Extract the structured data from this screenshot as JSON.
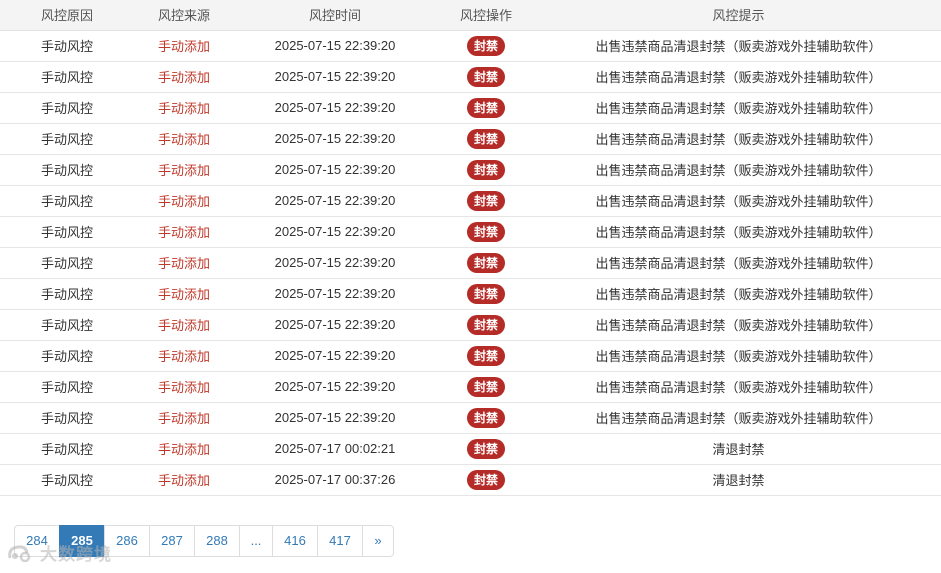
{
  "table": {
    "headers": [
      "风控原因",
      "风控来源",
      "风控时间",
      "风控操作",
      "风控提示"
    ],
    "rows": [
      {
        "reason": "手动风控",
        "source": "手动添加",
        "time": "2025-07-15 22:39:20",
        "action": "封禁",
        "tip": "出售违禁商品清退封禁（贩卖游戏外挂辅助软件）"
      },
      {
        "reason": "手动风控",
        "source": "手动添加",
        "time": "2025-07-15 22:39:20",
        "action": "封禁",
        "tip": "出售违禁商品清退封禁（贩卖游戏外挂辅助软件）"
      },
      {
        "reason": "手动风控",
        "source": "手动添加",
        "time": "2025-07-15 22:39:20",
        "action": "封禁",
        "tip": "出售违禁商品清退封禁（贩卖游戏外挂辅助软件）"
      },
      {
        "reason": "手动风控",
        "source": "手动添加",
        "time": "2025-07-15 22:39:20",
        "action": "封禁",
        "tip": "出售违禁商品清退封禁（贩卖游戏外挂辅助软件）"
      },
      {
        "reason": "手动风控",
        "source": "手动添加",
        "time": "2025-07-15 22:39:20",
        "action": "封禁",
        "tip": "出售违禁商品清退封禁（贩卖游戏外挂辅助软件）"
      },
      {
        "reason": "手动风控",
        "source": "手动添加",
        "time": "2025-07-15 22:39:20",
        "action": "封禁",
        "tip": "出售违禁商品清退封禁（贩卖游戏外挂辅助软件）"
      },
      {
        "reason": "手动风控",
        "source": "手动添加",
        "time": "2025-07-15 22:39:20",
        "action": "封禁",
        "tip": "出售违禁商品清退封禁（贩卖游戏外挂辅助软件）"
      },
      {
        "reason": "手动风控",
        "source": "手动添加",
        "time": "2025-07-15 22:39:20",
        "action": "封禁",
        "tip": "出售违禁商品清退封禁（贩卖游戏外挂辅助软件）"
      },
      {
        "reason": "手动风控",
        "source": "手动添加",
        "time": "2025-07-15 22:39:20",
        "action": "封禁",
        "tip": "出售违禁商品清退封禁（贩卖游戏外挂辅助软件）"
      },
      {
        "reason": "手动风控",
        "source": "手动添加",
        "time": "2025-07-15 22:39:20",
        "action": "封禁",
        "tip": "出售违禁商品清退封禁（贩卖游戏外挂辅助软件）"
      },
      {
        "reason": "手动风控",
        "source": "手动添加",
        "time": "2025-07-15 22:39:20",
        "action": "封禁",
        "tip": "出售违禁商品清退封禁（贩卖游戏外挂辅助软件）"
      },
      {
        "reason": "手动风控",
        "source": "手动添加",
        "time": "2025-07-15 22:39:20",
        "action": "封禁",
        "tip": "出售违禁商品清退封禁（贩卖游戏外挂辅助软件）"
      },
      {
        "reason": "手动风控",
        "source": "手动添加",
        "time": "2025-07-15 22:39:20",
        "action": "封禁",
        "tip": "出售违禁商品清退封禁（贩卖游戏外挂辅助软件）"
      },
      {
        "reason": "手动风控",
        "source": "手动添加",
        "time": "2025-07-17 00:02:21",
        "action": "封禁",
        "tip": "清退封禁"
      },
      {
        "reason": "手动风控",
        "source": "手动添加",
        "time": "2025-07-17 00:37:26",
        "action": "封禁",
        "tip": "清退封禁"
      }
    ]
  },
  "pagination": {
    "pages": [
      "284",
      "285",
      "286",
      "287",
      "288",
      "...",
      "416",
      "417",
      "»"
    ],
    "active": "285"
  },
  "watermark": {
    "text": "大数跨境"
  },
  "colors": {
    "badge": "#b52b27",
    "source_text": "#c0392b",
    "active_page": "#337ab7"
  }
}
